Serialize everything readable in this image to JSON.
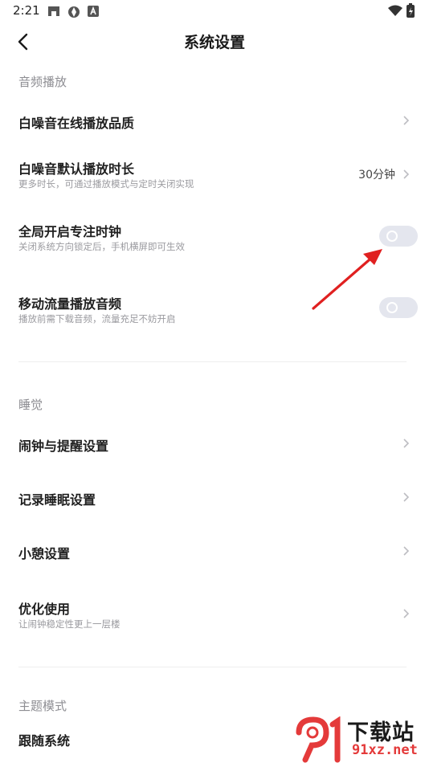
{
  "status_bar": {
    "time": "2:21"
  },
  "header": {
    "title": "系统设置",
    "back_icon": "chevron-left-icon"
  },
  "sections": {
    "audio": {
      "label": "音频播放",
      "quality": {
        "title": "白噪音在线播放品质"
      },
      "duration": {
        "title": "白噪音默认播放时长",
        "subtitle": "更多时长，可通过播放模式与定时关闭实现",
        "value": "30分钟"
      },
      "focus_clock": {
        "title": "全局开启专注时钟",
        "subtitle": "关闭系统方向锁定后，手机横屏即可生效",
        "enabled": false
      },
      "mobile_data": {
        "title": "移动流量播放音频",
        "subtitle": "播放前需下载音频，流量充足不妨开启",
        "enabled": false
      }
    },
    "sleep": {
      "label": "睡觉",
      "alarm": {
        "title": "闹钟与提醒设置"
      },
      "record": {
        "title": "记录睡眠设置"
      },
      "nap": {
        "title": "小憩设置"
      },
      "optimize": {
        "title": "优化使用",
        "subtitle": "让闹钟稳定性更上一层楼"
      }
    },
    "theme": {
      "label": "主题模式",
      "follow_system": {
        "title": "跟随系统"
      }
    }
  },
  "watermark": {
    "text": "下载站",
    "url": "91xz.net"
  },
  "colors": {
    "toggle_off": "#e4e6ee",
    "annotation_arrow": "#e02020",
    "watermark_red": "#e43a3a"
  }
}
